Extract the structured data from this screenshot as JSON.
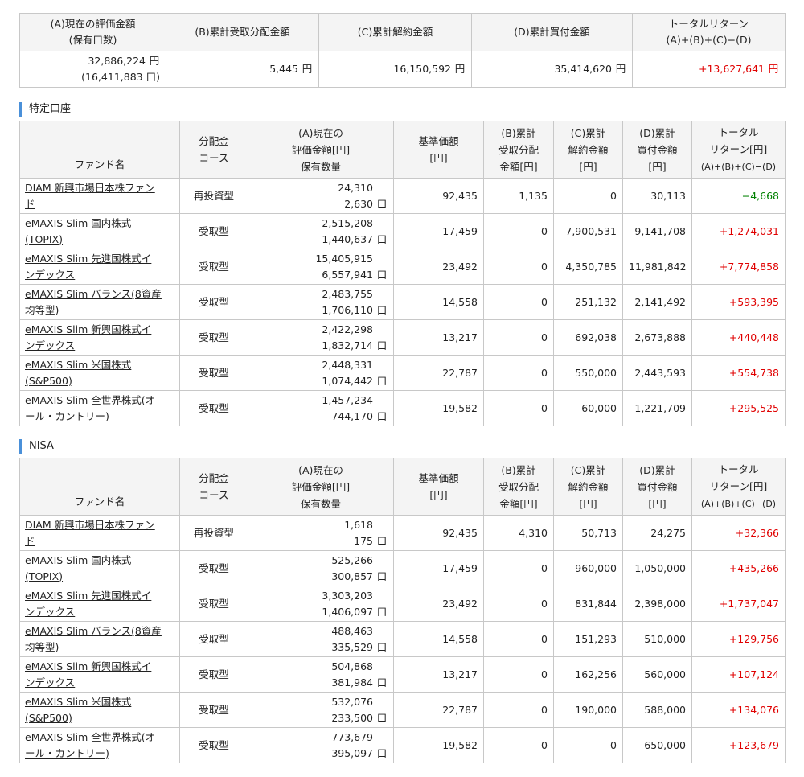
{
  "summary": {
    "headers": [
      [
        "(A)現在の評価金額",
        "(保有口数)"
      ],
      [
        "(B)累計受取分配金額"
      ],
      [
        "(C)累計解約金額"
      ],
      [
        "(D)累計買付金額"
      ],
      [
        "トータルリターン",
        "(A)+(B)+(C)−(D)"
      ]
    ],
    "values": [
      "32,886,224",
      "(16,411,883",
      "5,445",
      "16,150,592",
      "35,414,620",
      "+13,627,641"
    ],
    "yen": "円",
    "unit": "口)"
  },
  "units": {
    "yen": "円",
    "kuchi": "口"
  },
  "fund_headers": {
    "name": "ファンド名",
    "course": [
      "分配金",
      "コース"
    ],
    "valuation": [
      "(A)現在の",
      "評価金額[円]",
      "保有数量"
    ],
    "nav": [
      "基準価額",
      "[円]"
    ],
    "dist": [
      "(B)累計",
      "受取分配",
      "金額[円]"
    ],
    "sell": [
      "(C)累計",
      "解約金額",
      "[円]"
    ],
    "buy": [
      "(D)累計",
      "買付金額",
      "[円]"
    ],
    "ret": [
      "トータル",
      "リターン[円]",
      "(A)+(B)+(C)−(D)"
    ]
  },
  "sections": [
    {
      "title": "特定口座",
      "rows": [
        {
          "name": [
            "DIAM 新興市場日本株ファン",
            "ド"
          ],
          "course": "再投資型",
          "val": "24,310",
          "qty": "2,630",
          "nav": "92,435",
          "dist": "1,135",
          "sell": "0",
          "buy": "30,113",
          "ret": "−4,668",
          "sign": "neg"
        },
        {
          "name": [
            "eMAXIS Slim 国内株式",
            "(TOPIX)"
          ],
          "course": "受取型",
          "val": "2,515,208",
          "qty": "1,440,637",
          "nav": "17,459",
          "dist": "0",
          "sell": "7,900,531",
          "buy": "9,141,708",
          "ret": "+1,274,031",
          "sign": "pos"
        },
        {
          "name": [
            "eMAXIS Slim 先進国株式イ",
            "ンデックス"
          ],
          "course": "受取型",
          "val": "15,405,915",
          "qty": "6,557,941",
          "nav": "23,492",
          "dist": "0",
          "sell": "4,350,785",
          "buy": "11,981,842",
          "ret": "+7,774,858",
          "sign": "pos"
        },
        {
          "name": [
            "eMAXIS Slim バランス(8資産",
            "均等型)"
          ],
          "course": "受取型",
          "val": "2,483,755",
          "qty": "1,706,110",
          "nav": "14,558",
          "dist": "0",
          "sell": "251,132",
          "buy": "2,141,492",
          "ret": "+593,395",
          "sign": "pos"
        },
        {
          "name": [
            "eMAXIS Slim 新興国株式イ",
            "ンデックス"
          ],
          "course": "受取型",
          "val": "2,422,298",
          "qty": "1,832,714",
          "nav": "13,217",
          "dist": "0",
          "sell": "692,038",
          "buy": "2,673,888",
          "ret": "+440,448",
          "sign": "pos"
        },
        {
          "name": [
            "eMAXIS Slim 米国株式",
            "(S&P500)"
          ],
          "course": "受取型",
          "val": "2,448,331",
          "qty": "1,074,442",
          "nav": "22,787",
          "dist": "0",
          "sell": "550,000",
          "buy": "2,443,593",
          "ret": "+554,738",
          "sign": "pos"
        },
        {
          "name": [
            "eMAXIS Slim 全世界株式(オ",
            "ール・カントリー)"
          ],
          "course": "受取型",
          "val": "1,457,234",
          "qty": "744,170",
          "nav": "19,582",
          "dist": "0",
          "sell": "60,000",
          "buy": "1,221,709",
          "ret": "+295,525",
          "sign": "pos"
        }
      ]
    },
    {
      "title": "NISA",
      "rows": [
        {
          "name": [
            "DIAM 新興市場日本株ファン",
            "ド"
          ],
          "course": "再投資型",
          "val": "1,618",
          "qty": "175",
          "nav": "92,435",
          "dist": "4,310",
          "sell": "50,713",
          "buy": "24,275",
          "ret": "+32,366",
          "sign": "pos"
        },
        {
          "name": [
            "eMAXIS Slim 国内株式",
            "(TOPIX)"
          ],
          "course": "受取型",
          "val": "525,266",
          "qty": "300,857",
          "nav": "17,459",
          "dist": "0",
          "sell": "960,000",
          "buy": "1,050,000",
          "ret": "+435,266",
          "sign": "pos"
        },
        {
          "name": [
            "eMAXIS Slim 先進国株式イ",
            "ンデックス"
          ],
          "course": "受取型",
          "val": "3,303,203",
          "qty": "1,406,097",
          "nav": "23,492",
          "dist": "0",
          "sell": "831,844",
          "buy": "2,398,000",
          "ret": "+1,737,047",
          "sign": "pos"
        },
        {
          "name": [
            "eMAXIS Slim バランス(8資産",
            "均等型)"
          ],
          "course": "受取型",
          "val": "488,463",
          "qty": "335,529",
          "nav": "14,558",
          "dist": "0",
          "sell": "151,293",
          "buy": "510,000",
          "ret": "+129,756",
          "sign": "pos"
        },
        {
          "name": [
            "eMAXIS Slim 新興国株式イ",
            "ンデックス"
          ],
          "course": "受取型",
          "val": "504,868",
          "qty": "381,984",
          "nav": "13,217",
          "dist": "0",
          "sell": "162,256",
          "buy": "560,000",
          "ret": "+107,124",
          "sign": "pos"
        },
        {
          "name": [
            "eMAXIS Slim 米国株式",
            "(S&P500)"
          ],
          "course": "受取型",
          "val": "532,076",
          "qty": "233,500",
          "nav": "22,787",
          "dist": "0",
          "sell": "190,000",
          "buy": "588,000",
          "ret": "+134,076",
          "sign": "pos"
        },
        {
          "name": [
            "eMAXIS Slim 全世界株式(オ",
            "ール・カントリー)"
          ],
          "course": "受取型",
          "val": "773,679",
          "qty": "395,097",
          "nav": "19,582",
          "dist": "0",
          "sell": "0",
          "buy": "650,000",
          "ret": "+123,679",
          "sign": "pos"
        }
      ]
    }
  ]
}
